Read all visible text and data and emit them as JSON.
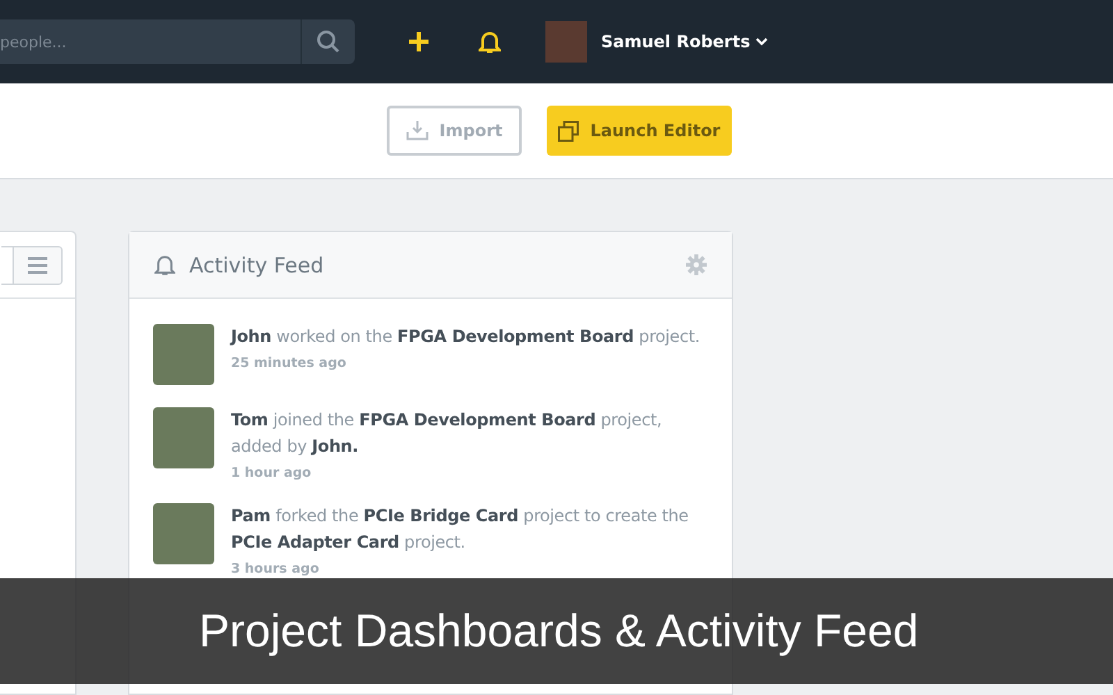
{
  "top_bar": {
    "search": {
      "placeholder": "people..."
    },
    "user": {
      "name": "Samuel Roberts"
    }
  },
  "toolbar": {
    "buttons": [
      {
        "label": "Import",
        "kind": "secondary"
      },
      {
        "label": "Launch Editor",
        "kind": "primary"
      }
    ]
  },
  "activity_feed": {
    "title": "Activity Feed",
    "items": [
      {
        "text": "**John** worked on the **FPGA Development Board** project.",
        "time": "25 minutes ago"
      },
      {
        "text": "**Tom** joined the **FPGA Development Board** project, added by **John.**",
        "time": "1 hour ago"
      },
      {
        "text": "**Pam** forked the **PCIe Bridge Card** project to create the **PCIe Adapter Card** project.",
        "time": "3 hours ago"
      }
    ]
  },
  "caption": "Project Dashboards & Activity Feed"
}
